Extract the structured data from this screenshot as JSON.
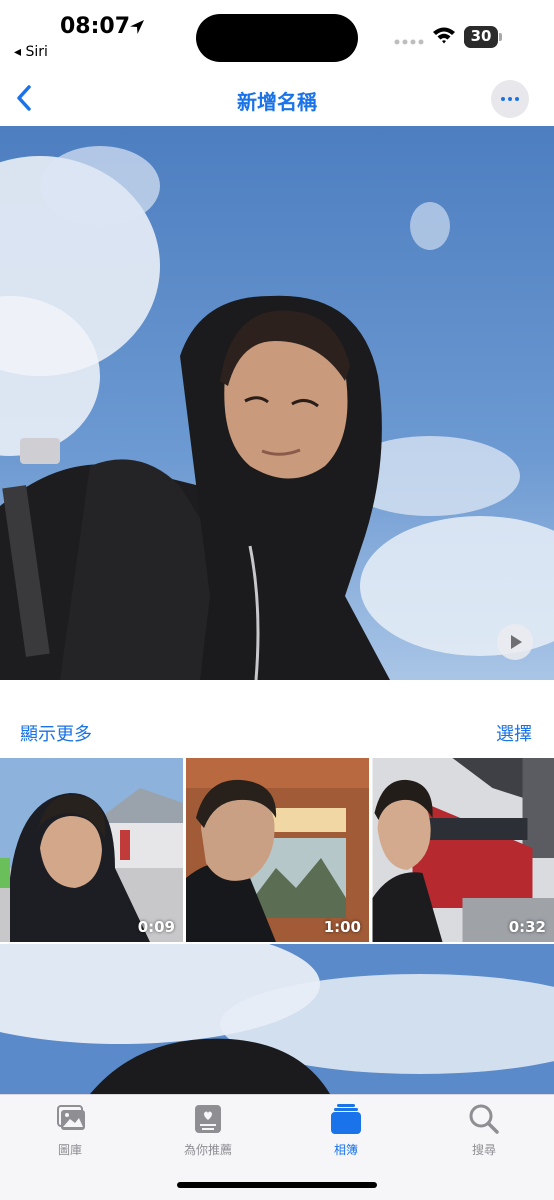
{
  "status_bar": {
    "time": "08:07",
    "back_app": "◂ Siri",
    "battery_level": 30,
    "battery_text": "30"
  },
  "nav": {
    "title": "新增名稱",
    "accent_color": "#1a73e8"
  },
  "section": {
    "show_more_label": "顯示更多",
    "select_label": "選擇"
  },
  "thumbnails": [
    {
      "duration": "0:09"
    },
    {
      "duration": "1:00"
    },
    {
      "duration": "0:32"
    }
  ],
  "tabs": [
    {
      "label": "圖庫",
      "icon": "photo-library-icon",
      "active": false
    },
    {
      "label": "為你推薦",
      "icon": "for-you-icon",
      "active": false
    },
    {
      "label": "相簿",
      "icon": "albums-icon",
      "active": true
    },
    {
      "label": "搜尋",
      "icon": "search-icon",
      "active": false
    }
  ]
}
